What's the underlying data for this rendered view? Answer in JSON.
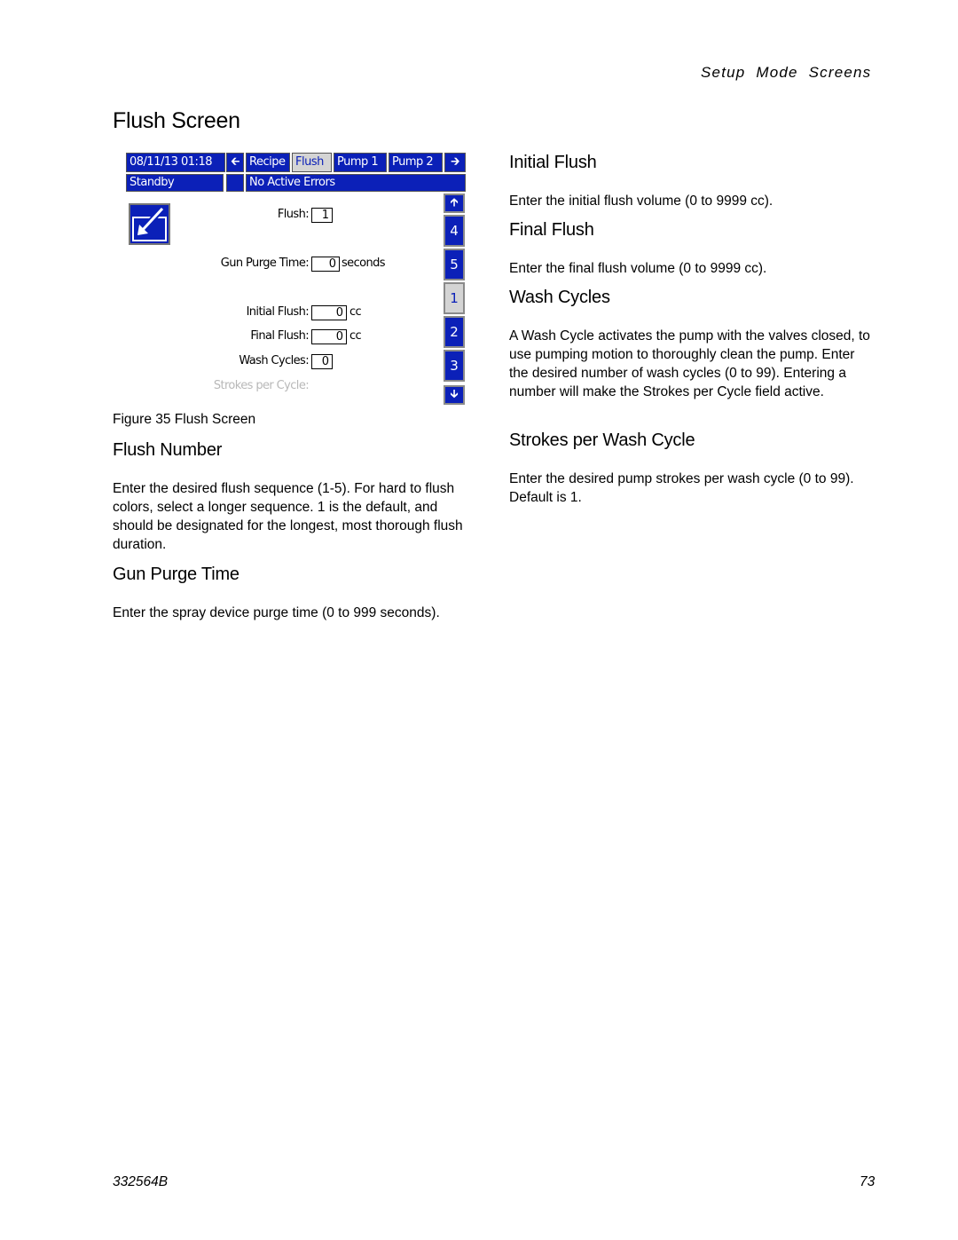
{
  "running_head": "Setup Mode Screens",
  "page_title": "Flush Screen",
  "hmi": {
    "date_time": "08/11/13 01:18",
    "tabs": [
      {
        "label": "Recipe",
        "active": false
      },
      {
        "label": "Flush",
        "active": true
      },
      {
        "label": "Pump 1",
        "active": false
      },
      {
        "label": "Pump 2",
        "active": false
      }
    ],
    "status": "Standby",
    "errors": "No Active Errors",
    "fields": {
      "flush": {
        "label": "Flush:",
        "value": "1"
      },
      "gun_purge_time": {
        "label": "Gun Purge Time:",
        "value": "0",
        "unit": "seconds"
      },
      "initial_flush": {
        "label": "Initial Flush:",
        "value": "0",
        "unit": "cc"
      },
      "final_flush": {
        "label": "Final Flush:",
        "value": "0",
        "unit": "cc"
      },
      "wash_cycles": {
        "label": "Wash Cycles:",
        "value": "0"
      },
      "strokes_per_cycle": {
        "label": "Strokes per Cycle:"
      }
    },
    "sequence_buttons": [
      {
        "label": "4",
        "active": false
      },
      {
        "label": "5",
        "active": false
      },
      {
        "label": "1",
        "active": true
      },
      {
        "label": "2",
        "active": false
      },
      {
        "label": "3",
        "active": false
      }
    ],
    "colors": {
      "blue": "#0b20b8",
      "active_gray": "#d4d4d4"
    }
  },
  "figure_caption": "Figure 35  Flush Screen",
  "left_sections": [
    {
      "heading": "Flush Number",
      "body": "Enter the desired flush sequence (1-5).  For hard to flush colors, select a longer sequence.  1 is the default, and should be designated for the longest, most thorough flush duration."
    },
    {
      "heading": "Gun Purge Time",
      "body": "Enter the spray device purge time (0 to 999 seconds)."
    }
  ],
  "right_sections": [
    {
      "heading": "Initial Flush",
      "body": "Enter the initial flush volume (0 to 9999 cc)."
    },
    {
      "heading": "Final Flush",
      "body": "Enter the final flush volume (0 to 9999 cc)."
    },
    {
      "heading": "Wash Cycles",
      "body": "A Wash Cycle activates the pump with the valves closed, to use pumping motion to thoroughly clean the pump.  Enter the desired number of wash cycles (0 to 99).  Entering a number will make the Strokes per Cycle field active."
    },
    {
      "heading": "Strokes per Wash Cycle",
      "body": "Enter the desired pump strokes per wash cycle (0 to 99).  Default is 1."
    }
  ],
  "footer": {
    "doc_number": "332564B",
    "page_number": "73"
  }
}
